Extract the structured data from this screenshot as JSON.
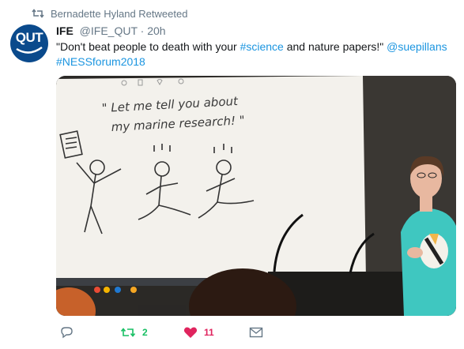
{
  "retweet_banner": {
    "text": "Bernadette Hyland Retweeted",
    "icon": "retweet-icon"
  },
  "author": {
    "avatar_text": "QUT",
    "avatar_color": "#0a4a8c",
    "name": "IFE",
    "handle": "@IFE_QUT",
    "separator": "·",
    "time": "20h"
  },
  "tweet": {
    "text_part1": "\"Don't beat people to death with your ",
    "hashtag1": "#science",
    "text_part2": " and nature papers!\" ",
    "mention": "@suepillans",
    "hashtag2": "#NESSforum2018"
  },
  "media": {
    "slide_caption_line1": "\" Let me tell you about",
    "slide_caption_line2": "my marine research! \""
  },
  "actions": {
    "reply_icon": "reply-icon",
    "retweet_icon": "retweet-icon",
    "retweet_count": "2",
    "like_icon": "heart-icon",
    "like_count": "11",
    "dm_icon": "envelope-icon"
  },
  "colors": {
    "link": "#1b95e0",
    "retweet": "#17bf63",
    "like": "#e0245e",
    "muted": "#657786"
  }
}
